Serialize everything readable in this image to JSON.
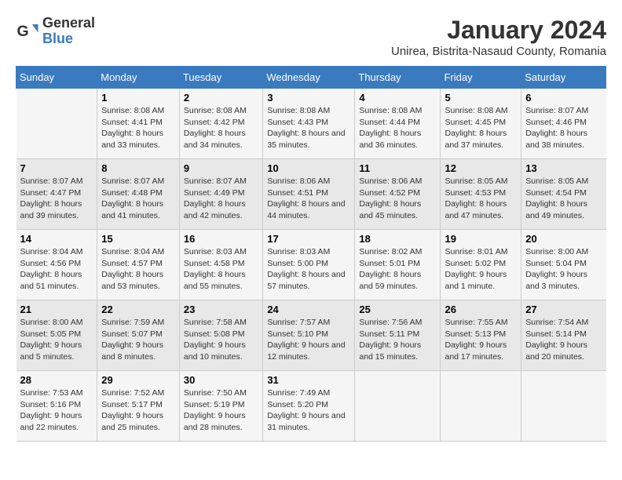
{
  "header": {
    "logo_line1": "General",
    "logo_line2": "Blue",
    "month": "January 2024",
    "location": "Unirea, Bistrita-Nasaud County, Romania"
  },
  "weekdays": [
    "Sunday",
    "Monday",
    "Tuesday",
    "Wednesday",
    "Thursday",
    "Friday",
    "Saturday"
  ],
  "weeks": [
    [
      {
        "day": "",
        "sunrise": "",
        "sunset": "",
        "daylight": ""
      },
      {
        "day": "1",
        "sunrise": "Sunrise: 8:08 AM",
        "sunset": "Sunset: 4:41 PM",
        "daylight": "Daylight: 8 hours and 33 minutes."
      },
      {
        "day": "2",
        "sunrise": "Sunrise: 8:08 AM",
        "sunset": "Sunset: 4:42 PM",
        "daylight": "Daylight: 8 hours and 34 minutes."
      },
      {
        "day": "3",
        "sunrise": "Sunrise: 8:08 AM",
        "sunset": "Sunset: 4:43 PM",
        "daylight": "Daylight: 8 hours and 35 minutes."
      },
      {
        "day": "4",
        "sunrise": "Sunrise: 8:08 AM",
        "sunset": "Sunset: 4:44 PM",
        "daylight": "Daylight: 8 hours and 36 minutes."
      },
      {
        "day": "5",
        "sunrise": "Sunrise: 8:08 AM",
        "sunset": "Sunset: 4:45 PM",
        "daylight": "Daylight: 8 hours and 37 minutes."
      },
      {
        "day": "6",
        "sunrise": "Sunrise: 8:07 AM",
        "sunset": "Sunset: 4:46 PM",
        "daylight": "Daylight: 8 hours and 38 minutes."
      }
    ],
    [
      {
        "day": "7",
        "sunrise": "Sunrise: 8:07 AM",
        "sunset": "Sunset: 4:47 PM",
        "daylight": "Daylight: 8 hours and 39 minutes."
      },
      {
        "day": "8",
        "sunrise": "Sunrise: 8:07 AM",
        "sunset": "Sunset: 4:48 PM",
        "daylight": "Daylight: 8 hours and 41 minutes."
      },
      {
        "day": "9",
        "sunrise": "Sunrise: 8:07 AM",
        "sunset": "Sunset: 4:49 PM",
        "daylight": "Daylight: 8 hours and 42 minutes."
      },
      {
        "day": "10",
        "sunrise": "Sunrise: 8:06 AM",
        "sunset": "Sunset: 4:51 PM",
        "daylight": "Daylight: 8 hours and 44 minutes."
      },
      {
        "day": "11",
        "sunrise": "Sunrise: 8:06 AM",
        "sunset": "Sunset: 4:52 PM",
        "daylight": "Daylight: 8 hours and 45 minutes."
      },
      {
        "day": "12",
        "sunrise": "Sunrise: 8:05 AM",
        "sunset": "Sunset: 4:53 PM",
        "daylight": "Daylight: 8 hours and 47 minutes."
      },
      {
        "day": "13",
        "sunrise": "Sunrise: 8:05 AM",
        "sunset": "Sunset: 4:54 PM",
        "daylight": "Daylight: 8 hours and 49 minutes."
      }
    ],
    [
      {
        "day": "14",
        "sunrise": "Sunrise: 8:04 AM",
        "sunset": "Sunset: 4:56 PM",
        "daylight": "Daylight: 8 hours and 51 minutes."
      },
      {
        "day": "15",
        "sunrise": "Sunrise: 8:04 AM",
        "sunset": "Sunset: 4:57 PM",
        "daylight": "Daylight: 8 hours and 53 minutes."
      },
      {
        "day": "16",
        "sunrise": "Sunrise: 8:03 AM",
        "sunset": "Sunset: 4:58 PM",
        "daylight": "Daylight: 8 hours and 55 minutes."
      },
      {
        "day": "17",
        "sunrise": "Sunrise: 8:03 AM",
        "sunset": "Sunset: 5:00 PM",
        "daylight": "Daylight: 8 hours and 57 minutes."
      },
      {
        "day": "18",
        "sunrise": "Sunrise: 8:02 AM",
        "sunset": "Sunset: 5:01 PM",
        "daylight": "Daylight: 8 hours and 59 minutes."
      },
      {
        "day": "19",
        "sunrise": "Sunrise: 8:01 AM",
        "sunset": "Sunset: 5:02 PM",
        "daylight": "Daylight: 9 hours and 1 minute."
      },
      {
        "day": "20",
        "sunrise": "Sunrise: 8:00 AM",
        "sunset": "Sunset: 5:04 PM",
        "daylight": "Daylight: 9 hours and 3 minutes."
      }
    ],
    [
      {
        "day": "21",
        "sunrise": "Sunrise: 8:00 AM",
        "sunset": "Sunset: 5:05 PM",
        "daylight": "Daylight: 9 hours and 5 minutes."
      },
      {
        "day": "22",
        "sunrise": "Sunrise: 7:59 AM",
        "sunset": "Sunset: 5:07 PM",
        "daylight": "Daylight: 9 hours and 8 minutes."
      },
      {
        "day": "23",
        "sunrise": "Sunrise: 7:58 AM",
        "sunset": "Sunset: 5:08 PM",
        "daylight": "Daylight: 9 hours and 10 minutes."
      },
      {
        "day": "24",
        "sunrise": "Sunrise: 7:57 AM",
        "sunset": "Sunset: 5:10 PM",
        "daylight": "Daylight: 9 hours and 12 minutes."
      },
      {
        "day": "25",
        "sunrise": "Sunrise: 7:56 AM",
        "sunset": "Sunset: 5:11 PM",
        "daylight": "Daylight: 9 hours and 15 minutes."
      },
      {
        "day": "26",
        "sunrise": "Sunrise: 7:55 AM",
        "sunset": "Sunset: 5:13 PM",
        "daylight": "Daylight: 9 hours and 17 minutes."
      },
      {
        "day": "27",
        "sunrise": "Sunrise: 7:54 AM",
        "sunset": "Sunset: 5:14 PM",
        "daylight": "Daylight: 9 hours and 20 minutes."
      }
    ],
    [
      {
        "day": "28",
        "sunrise": "Sunrise: 7:53 AM",
        "sunset": "Sunset: 5:16 PM",
        "daylight": "Daylight: 9 hours and 22 minutes."
      },
      {
        "day": "29",
        "sunrise": "Sunrise: 7:52 AM",
        "sunset": "Sunset: 5:17 PM",
        "daylight": "Daylight: 9 hours and 25 minutes."
      },
      {
        "day": "30",
        "sunrise": "Sunrise: 7:50 AM",
        "sunset": "Sunset: 5:19 PM",
        "daylight": "Daylight: 9 hours and 28 minutes."
      },
      {
        "day": "31",
        "sunrise": "Sunrise: 7:49 AM",
        "sunset": "Sunset: 5:20 PM",
        "daylight": "Daylight: 9 hours and 31 minutes."
      },
      {
        "day": "",
        "sunrise": "",
        "sunset": "",
        "daylight": ""
      },
      {
        "day": "",
        "sunrise": "",
        "sunset": "",
        "daylight": ""
      },
      {
        "day": "",
        "sunrise": "",
        "sunset": "",
        "daylight": ""
      }
    ]
  ]
}
